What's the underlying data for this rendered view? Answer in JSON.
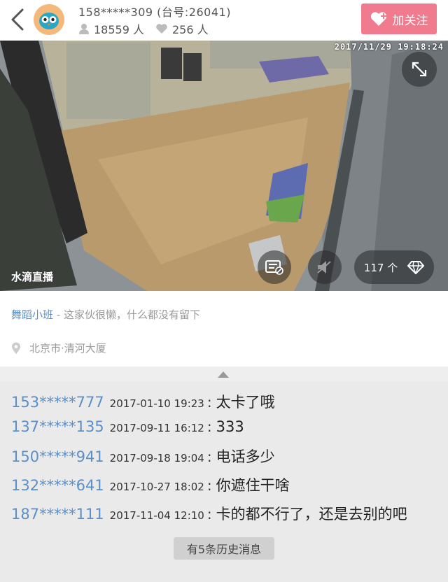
{
  "header": {
    "room_name": "158*****309 (台号:26041)",
    "viewers": "18559 人",
    "likes": "256 人",
    "follow_label": "加关注",
    "accent_color": "#f07a8e"
  },
  "video": {
    "timestamp": "2017/11/29  19:18:24",
    "watermark": "水滴直播",
    "gift_count": "117 个"
  },
  "info": {
    "room_title": "舞蹈小班",
    "description": " - 这家伙很懒，什么都没有留下",
    "location": "北京市·清河大厦"
  },
  "chat": {
    "messages": [
      {
        "user": "153*****777",
        "time": "2017-01-10 19:23",
        "text": "太卡了哦"
      },
      {
        "user": "137*****135",
        "time": "2017-09-11 16:12",
        "text": "333"
      },
      {
        "user": "150*****941",
        "time": "2017-09-18 19:04",
        "text": "电话多少"
      },
      {
        "user": "132*****641",
        "time": "2017-10-27 18:02",
        "text": "你遮住干啥"
      },
      {
        "user": "187*****111",
        "time": "2017-11-04 12:10",
        "text": "卡的都不行了，还是去别的吧"
      }
    ],
    "history_label": "有5条历史消息"
  }
}
